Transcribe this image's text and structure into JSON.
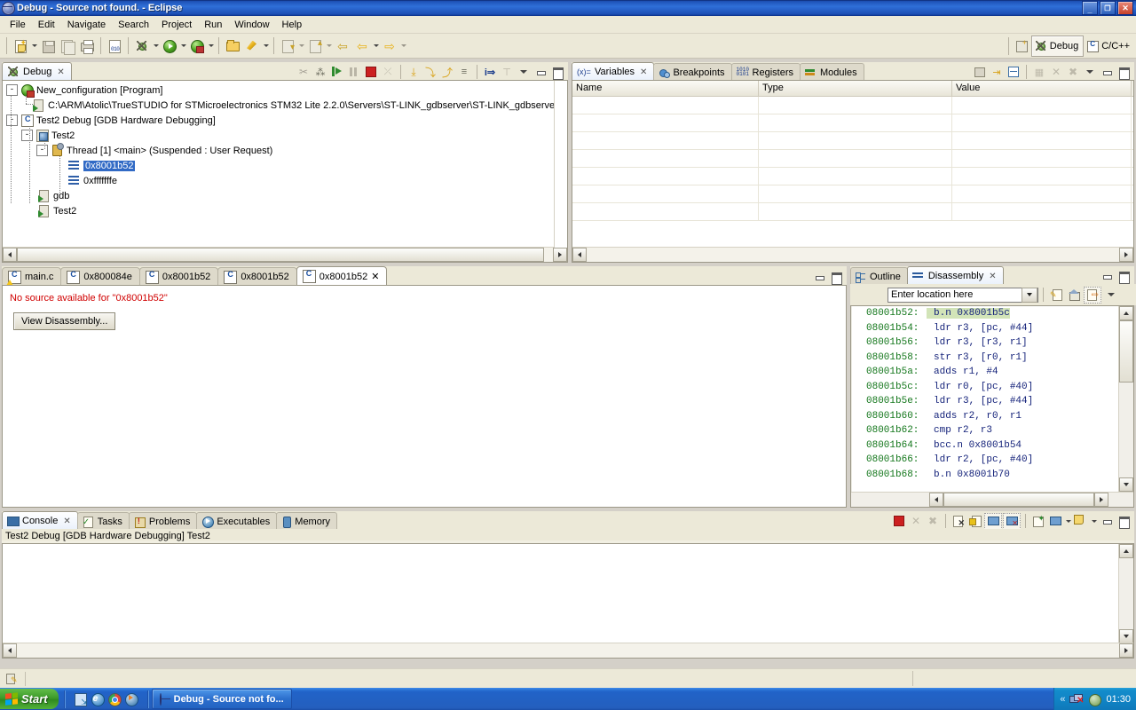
{
  "window": {
    "title": "Debug - Source not found. - Eclipse",
    "minimize_label": "_",
    "restore_label": "❐",
    "close_label": "✕"
  },
  "menubar": {
    "items": [
      "File",
      "Edit",
      "Navigate",
      "Search",
      "Project",
      "Run",
      "Window",
      "Help"
    ]
  },
  "toolbar": {
    "icons": [
      "new-icon",
      "save-icon",
      "save-all-icon",
      "print-icon",
      "binary-icon",
      "debug-icon",
      "run-icon",
      "external-tools-icon",
      "open-resource-icon",
      "marker-icon",
      "next-annotation-icon",
      "previous-annotation-icon",
      "back-icon",
      "forward-icon"
    ]
  },
  "perspectives": {
    "items": [
      {
        "label": "Debug",
        "icon": "debug-perspective-icon",
        "active": true
      },
      {
        "label": "C/C++",
        "icon": "cpp-perspective-icon",
        "active": false
      }
    ]
  },
  "debug_view": {
    "tabs": [
      {
        "label": "Debug",
        "icon": "debug-icon",
        "active": true,
        "close": "✕"
      }
    ],
    "toolbar_icons": [
      "disconnect-icon",
      "remove-all-terminated-icon",
      "resume-icon",
      "suspend-icon",
      "terminate-icon",
      "disconnect2-icon",
      "step-into-icon",
      "step-over-icon",
      "step-return-icon",
      "drop-to-frame-icon",
      "instruction-stepping-icon",
      "use-step-filters-icon",
      "view-menu-icon",
      "minimize-icon",
      "maximize-icon"
    ],
    "tree": [
      {
        "indent": 0,
        "expander": "-",
        "icon": "launch-icon",
        "label": "New_configuration [Program]",
        "selected": false
      },
      {
        "indent": 1,
        "expander": "",
        "icon": "process-icon",
        "label": "C:\\ARM\\Atolic\\TrueSTUDIO for STMicroelectronics STM32 Lite 2.2.0\\Servers\\ST-LINK_gdbserver\\ST-LINK_gdbserver.e",
        "selected": false
      },
      {
        "indent": 0,
        "expander": "-",
        "icon": "c-project-icon",
        "label": "Test2 Debug [GDB Hardware Debugging]",
        "selected": false
      },
      {
        "indent": 1,
        "expander": "-",
        "icon": "target-icon",
        "label": "Test2",
        "selected": false
      },
      {
        "indent": 2,
        "expander": "-",
        "icon": "thread-icon",
        "label": "Thread [1] <main> (Suspended : User Request)",
        "selected": false
      },
      {
        "indent": 3,
        "expander": "",
        "icon": "stack-frame-icon",
        "label": "0x8001b52",
        "selected": true
      },
      {
        "indent": 3,
        "expander": "",
        "icon": "stack-frame-icon",
        "label": "0xfffffffe",
        "selected": false
      },
      {
        "indent": 1,
        "expander": "",
        "icon": "process-icon",
        "label": "gdb",
        "selected": false
      },
      {
        "indent": 1,
        "expander": "",
        "icon": "process-icon",
        "label": "Test2",
        "selected": false
      }
    ]
  },
  "variables_view": {
    "tabs": [
      {
        "label": "Variables",
        "icon": "variables-icon",
        "active": true,
        "close": "✕"
      },
      {
        "label": "Breakpoints",
        "icon": "breakpoints-icon",
        "active": false
      },
      {
        "label": "Registers",
        "icon": "registers-icon",
        "active": false
      },
      {
        "label": "Modules",
        "icon": "modules-icon",
        "active": false
      }
    ],
    "toolbar_icons": [
      "show-type-names-icon",
      "show-logical-structure-icon",
      "collapse-all-icon",
      "add-watch-icon",
      "remove-icon",
      "remove-all-icon",
      "view-menu-icon",
      "minimize-icon",
      "maximize-icon"
    ],
    "columns": [
      "Name",
      "Type",
      "Value"
    ],
    "rows": []
  },
  "editor": {
    "tabs": [
      {
        "label": "main.c",
        "icon": "c-file-warning-icon",
        "active": false
      },
      {
        "label": "0x800084e",
        "icon": "c-file-icon",
        "active": false
      },
      {
        "label": "0x8001b52",
        "icon": "c-file-icon",
        "active": false
      },
      {
        "label": "0x8001b52",
        "icon": "c-file-icon",
        "active": false
      },
      {
        "label": "0x8001b52",
        "icon": "c-file-icon",
        "active": true,
        "close": "✕"
      }
    ],
    "message": "No source available for \"0x8001b52\"",
    "message_color": "#d00000",
    "button_label": "View Disassembly...",
    "minimize_icon": "minimize-icon",
    "maximize_icon": "maximize-icon"
  },
  "disassembly_view": {
    "tabs": [
      {
        "label": "Outline",
        "icon": "outline-icon",
        "active": false
      },
      {
        "label": "Disassembly",
        "icon": "disassembly-icon",
        "active": true,
        "close": "✕"
      }
    ],
    "location_placeholder": "Enter location here",
    "location_value": "",
    "toolbar_icons": [
      "show-source-icon",
      "home-icon",
      "link-to-frame-icon",
      "view-menu-icon"
    ],
    "minimize_icon": "minimize-icon",
    "maximize_icon": "maximize-icon",
    "current_marker": "current-instruction-pointer-icon",
    "lines": [
      {
        "address": "08001b52:",
        "instruction": "b.n  0x8001b5c",
        "current": true
      },
      {
        "address": "08001b54:",
        "instruction": "ldr  r3, [pc, #44]",
        "current": false
      },
      {
        "address": "08001b56:",
        "instruction": "ldr  r3, [r3, r1]",
        "current": false
      },
      {
        "address": "08001b58:",
        "instruction": "str  r3, [r0, r1]",
        "current": false
      },
      {
        "address": "08001b5a:",
        "instruction": "adds r1, #4",
        "current": false
      },
      {
        "address": "08001b5c:",
        "instruction": "ldr  r0, [pc, #40]",
        "current": false
      },
      {
        "address": "08001b5e:",
        "instruction": "ldr  r3, [pc, #44]",
        "current": false
      },
      {
        "address": "08001b60:",
        "instruction": "adds r2, r0, r1",
        "current": false
      },
      {
        "address": "08001b62:",
        "instruction": "cmp  r2, r3",
        "current": false
      },
      {
        "address": "08001b64:",
        "instruction": "bcc.n 0x8001b54",
        "current": false
      },
      {
        "address": "08001b66:",
        "instruction": "ldr  r2, [pc, #40]",
        "current": false
      },
      {
        "address": "08001b68:",
        "instruction": "b.n  0x8001b70",
        "current": false
      }
    ]
  },
  "console_view": {
    "tabs": [
      {
        "label": "Console",
        "icon": "console-icon",
        "active": true,
        "close": "✕"
      },
      {
        "label": "Tasks",
        "icon": "tasks-icon",
        "active": false
      },
      {
        "label": "Problems",
        "icon": "problems-icon",
        "active": false
      },
      {
        "label": "Executables",
        "icon": "executables-icon",
        "active": false
      },
      {
        "label": "Memory",
        "icon": "memory-icon",
        "active": false
      }
    ],
    "toolbar_icons": [
      "terminate-icon",
      "remove-launch-icon",
      "remove-all-launches-icon",
      "clear-console-icon",
      "scroll-lock-icon",
      "pin-console-icon",
      "display-selected-console-icon",
      "open-console-icon",
      "new-console-view-icon",
      "minimize-icon",
      "maximize-icon"
    ],
    "header_text": "Test2 Debug [GDB Hardware Debugging] Test2",
    "content": ""
  },
  "statusbar": {
    "icon": "writable-icon",
    "text": ""
  },
  "taskbar": {
    "start_label": "Start",
    "quick_launch": [
      "show-desktop-icon",
      "internet-explorer-icon",
      "chrome-icon",
      "media-player-icon"
    ],
    "tasks": [
      {
        "label": "Debug - Source not fo...",
        "icon": "eclipse-icon",
        "active": true
      }
    ],
    "tray": {
      "chevron": "«",
      "icons": [
        "network-disconnected-icon",
        "security-icon"
      ],
      "clock": "01:30"
    }
  },
  "colors": {
    "accent": "#316ac5",
    "title_bar": "#2f6fd8",
    "panel_bg": "#ece9d8",
    "error_text": "#d00000",
    "address_text": "#12761a",
    "instruction_text": "#14227a",
    "current_line_bg": "#d2e4b8"
  }
}
